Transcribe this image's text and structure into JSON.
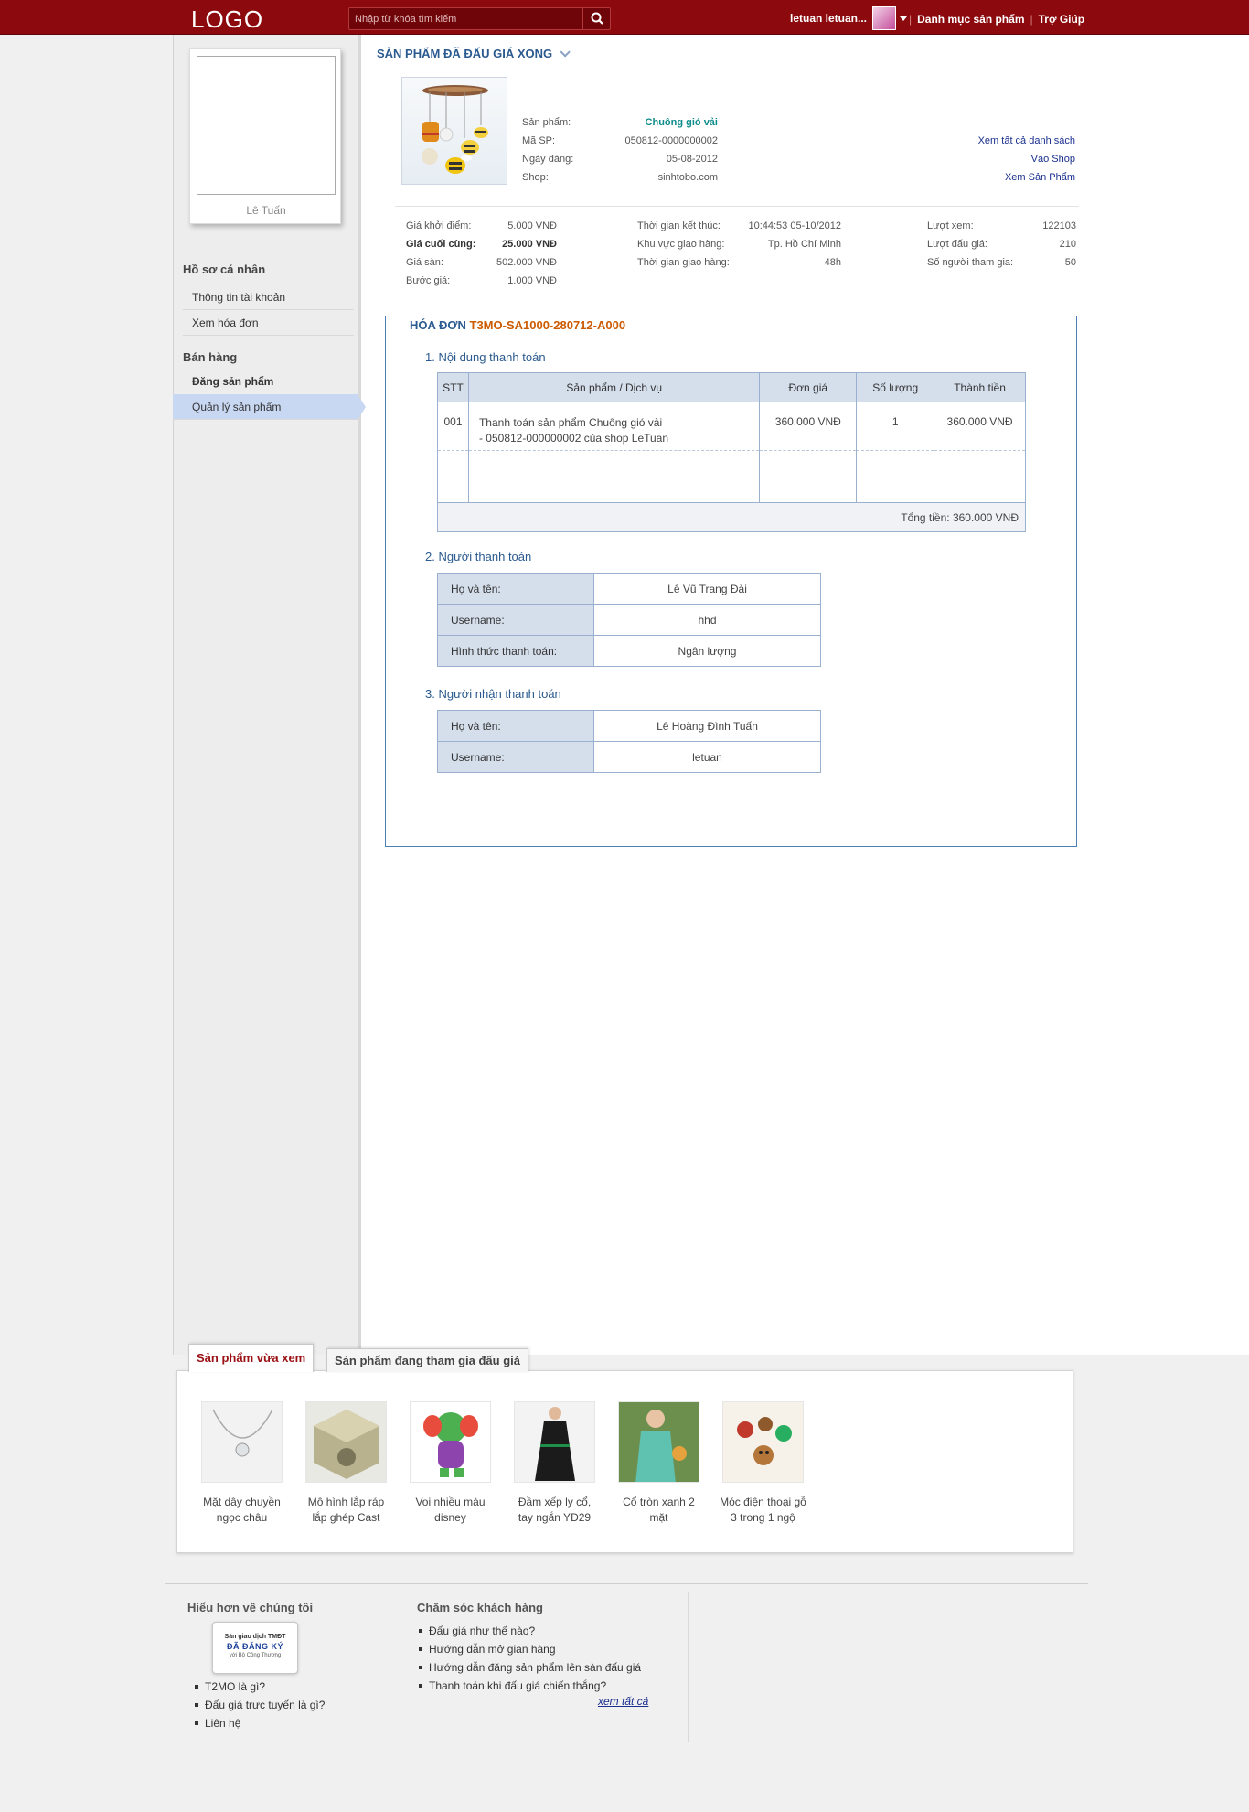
{
  "header": {
    "logo": "LOGO",
    "search_placeholder": "Nhập từ khóa tìm kiếm",
    "username": "letuan letuan...",
    "links": [
      "Danh mục sản phẩm",
      "Trợ Giúp"
    ]
  },
  "sidebar": {
    "profile_name": "Lê Tuấn",
    "groups": [
      {
        "heading": "Hồ sơ cá nhân",
        "items": [
          "Thông tin tài khoản",
          "Xem hóa đơn"
        ]
      },
      {
        "heading": "Bán hàng",
        "items": [
          "Đăng sản phẩm",
          "Quản lý sản phẩm"
        ]
      }
    ],
    "active_item": "Quản lý sản phẩm"
  },
  "product": {
    "section_title": "SẢN PHẨM ĐÃ ĐẤU GIÁ XONG",
    "fields": [
      {
        "label": "Sản phẩm:",
        "value": "Chuông gió vải"
      },
      {
        "label": "Mã SP:",
        "value": "050812-0000000002"
      },
      {
        "label": "Ngày đăng:",
        "value": "05-08-2012"
      },
      {
        "label": "Shop:",
        "value": "sinhtobo.com"
      }
    ],
    "links": [
      "Xem tất cả danh sách",
      "Vào Shop",
      "Xem Sản Phẩm"
    ]
  },
  "stats": {
    "col1": [
      {
        "label": "Giá khởi điểm:",
        "value": "5.000 VNĐ"
      },
      {
        "label": "Giá cuối cùng:",
        "value": "25.000 VNĐ"
      },
      {
        "label": "Giá sàn:",
        "value": "502.000 VNĐ"
      },
      {
        "label": "Bước giá:",
        "value": "1.000 VNĐ"
      }
    ],
    "col2": [
      {
        "label": "Thời gian kết thúc:",
        "value": "10:44:53 05-10/2012"
      },
      {
        "label": "Khu vực giao hàng:",
        "value": "Tp. Hồ Chí Minh"
      },
      {
        "label": "Thời gian giao hàng:",
        "value": "48h"
      }
    ],
    "col3": [
      {
        "label": "Lượt xem:",
        "value": "122103"
      },
      {
        "label": "Lượt đấu giá:",
        "value": "210"
      },
      {
        "label": "Số người tham gia:",
        "value": "50"
      }
    ]
  },
  "invoice": {
    "title_prefix": "HÓA ĐƠN",
    "code": "T3MO-SA1000-280712-A000",
    "section1": "1. Nội dung thanh toán",
    "columns": [
      "STT",
      "Sản phẩm / Dịch vụ",
      "Đơn giá",
      "Số lượng",
      "Thành tiền"
    ],
    "rows": [
      {
        "stt": "001",
        "desc_line1": "Thanh toán sản phẩm Chuông gió vải",
        "desc_line2": "- 050812-000000002 của shop LeTuan",
        "unit_price": "360.000 VNĐ",
        "qty": "1",
        "amount": "360.000 VNĐ"
      }
    ],
    "total": "Tổng tiền: 360.000 VNĐ",
    "section2": "2. Người thanh toán",
    "payer": [
      {
        "label": "Họ và tên:",
        "value": "Lê Vũ Trang Đài"
      },
      {
        "label": "Username:",
        "value": "hhd"
      },
      {
        "label": "Hình thức thanh toán:",
        "value": "Ngân lượng"
      }
    ],
    "section3": "3. Người nhận thanh toán",
    "receiver": [
      {
        "label": "Họ và tên:",
        "value": "Lê Hoàng Đình Tuấn"
      },
      {
        "label": "Username:",
        "value": "letuan"
      }
    ]
  },
  "recent": {
    "tabs": [
      "Sản phẩm vừa xem",
      "Sản phẩm đang tham gia đấu giá"
    ],
    "items": [
      {
        "line1": "Mặt dây chuyền",
        "line2": "ngọc châu"
      },
      {
        "line1": "Mô hình lắp ráp",
        "line2": "lắp ghép Cast"
      },
      {
        "line1": "Voi nhiều màu",
        "line2": "disney"
      },
      {
        "line1": "Đầm xếp ly cổ,",
        "line2": "tay ngắn YD29"
      },
      {
        "line1": "Cổ tròn xanh 2",
        "line2": "mặt"
      },
      {
        "line1": "Móc điện thoại gỗ",
        "line2": "3 trong 1 ngộ"
      }
    ]
  },
  "footer": {
    "col1_title": "Hiểu hơn về chúng tôi",
    "badge": [
      "Sàn giao dịch TMĐT",
      "ĐÃ ĐĂNG KÝ",
      "với Bộ Công Thương"
    ],
    "col1_links": [
      "T2MO là gì?",
      "Đấu giá trực tuyến là gì?",
      "Liên hệ"
    ],
    "col2_title": "Chăm sóc khách hàng",
    "col2_links": [
      "Đấu giá như thế nào?",
      "Hướng dẫn mở gian hàng",
      "Hướng dẫn đăng sản phẩm lên sàn đấu giá",
      "Thanh toán khi đấu giá chiến thắng?"
    ],
    "see_all": "xem tất cả"
  }
}
